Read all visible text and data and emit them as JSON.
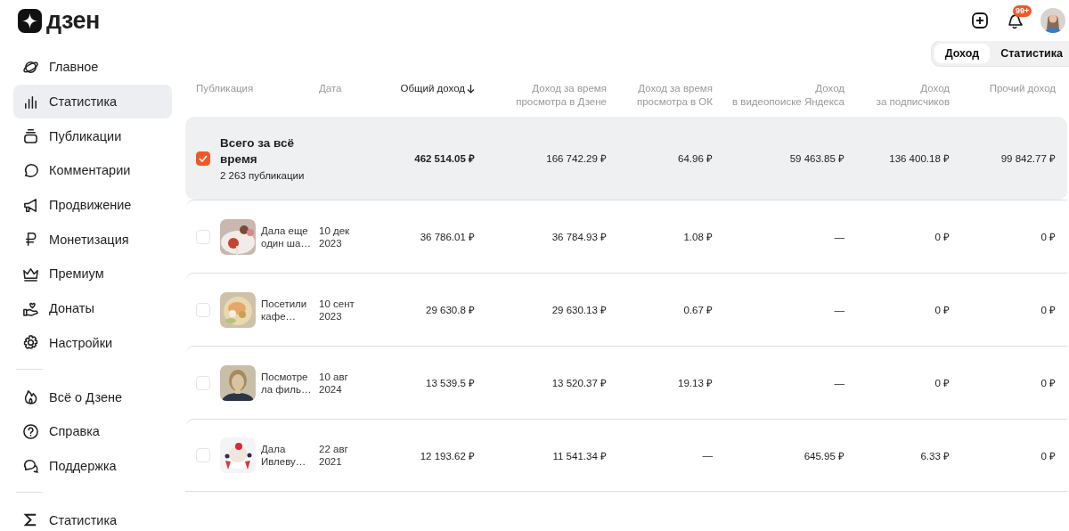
{
  "logo": "дзен",
  "header": {
    "notifications_badge": "99+"
  },
  "nav": [
    {
      "label": "Главное",
      "selected": false
    },
    {
      "label": "Статистика",
      "selected": true
    },
    {
      "label": "Публикации",
      "selected": false
    },
    {
      "label": "Комментарии",
      "selected": false
    },
    {
      "label": "Продвижение",
      "selected": false
    },
    {
      "label": "Монетизация",
      "selected": false
    },
    {
      "label": "Премиум",
      "selected": false
    },
    {
      "label": "Донаты",
      "selected": false
    },
    {
      "label": "Настройки",
      "selected": false
    }
  ],
  "nav_secondary": [
    {
      "label": "Всё о Дзене",
      "selected": false
    },
    {
      "label": "Справка",
      "selected": false
    },
    {
      "label": "Поддержка",
      "selected": false
    }
  ],
  "nav_bottom": [
    {
      "label": "Статистика",
      "selected": false
    }
  ],
  "view_tabs": [
    {
      "label": "Доход",
      "selected": true
    },
    {
      "label": "Статистика",
      "selected": false
    }
  ],
  "table": {
    "columns": [
      {
        "label": "Публикация",
        "sorted": false
      },
      {
        "label": "Дата",
        "sorted": false
      },
      {
        "label": "Общий доход",
        "sorted": true
      },
      {
        "label": "Доход за время\nпросмотра в Дзене",
        "sorted": false
      },
      {
        "label": "Доход за время\nпросмотра в ОК",
        "sorted": false
      },
      {
        "label": "Доход\nв видеопоиске Яндекса",
        "sorted": false
      },
      {
        "label": "Доход\nза подписчиков",
        "sorted": false
      },
      {
        "label": "Прочий доход",
        "sorted": false
      }
    ],
    "total": {
      "checked": true,
      "title": "Всего за всё\nвремя",
      "subtitle": "2 263 публикации",
      "values": [
        "462 514.05 ₽",
        "166 742.29 ₽",
        "64.96 ₽",
        "59 463.85 ₽",
        "136 400.18 ₽",
        "99 842.77 ₽"
      ]
    },
    "rows": [
      {
        "checked": false,
        "title": "Дала еще\nодин ша…",
        "date": "10 дек\n2023",
        "values": [
          "36 786.01 ₽",
          "36 784.93 ₽",
          "1.08 ₽",
          "—",
          "0 ₽",
          "0 ₽"
        ]
      },
      {
        "checked": false,
        "title": "Посетили\nкафе…",
        "date": "10 сент\n2023",
        "values": [
          "29 630.8 ₽",
          "29 630.13 ₽",
          "0.67 ₽",
          "—",
          "0 ₽",
          "0 ₽"
        ]
      },
      {
        "checked": false,
        "title": "Посмотре\nла филь…",
        "date": "10 авг\n2024",
        "values": [
          "13 539.5 ₽",
          "13 520.37 ₽",
          "19.13 ₽",
          "—",
          "0 ₽",
          "0 ₽"
        ]
      },
      {
        "checked": false,
        "title": "Дала\nИвлеву…",
        "date": "22 авг\n2021",
        "values": [
          "12 193.62 ₽",
          "11 541.34 ₽",
          "—",
          "645.95 ₽",
          "6.33 ₽",
          "0 ₽"
        ]
      }
    ]
  }
}
